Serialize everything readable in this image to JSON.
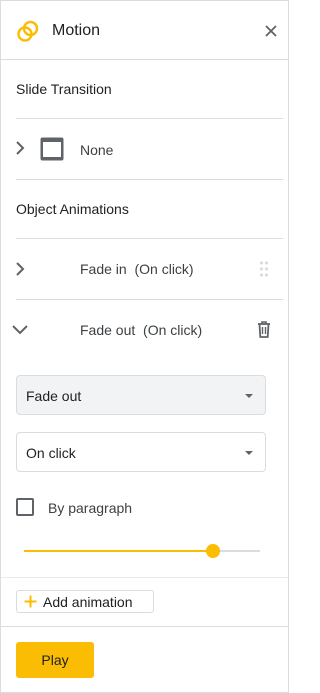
{
  "header": {
    "title": "Motion"
  },
  "slide_transition": {
    "section_title": "Slide Transition",
    "value": "None"
  },
  "object_animations": {
    "section_title": "Object Animations",
    "items": [
      {
        "label": "Fade in  (On click)",
        "expanded": false
      },
      {
        "label": "Fade out  (On click)",
        "expanded": true
      }
    ],
    "effect_select": {
      "value": "Fade out"
    },
    "trigger_select": {
      "value": "On click"
    },
    "by_paragraph": {
      "label": "By paragraph",
      "checked": false
    },
    "speed_slider": {
      "value": 0.8
    }
  },
  "footer": {
    "add_animation_label": "Add animation",
    "play_label": "Play"
  },
  "colors": {
    "accent": "#fbbc04",
    "border": "#dadce0",
    "select_bg": "#f1f3f4",
    "icon": "#5f6368"
  },
  "icons": {
    "logo": "motion-logo-icon",
    "close": "close-icon",
    "expand": "chevron-right-icon",
    "collapse": "chevron-down-icon",
    "transition_thumb": "slide-thumbnail-icon",
    "drag": "drag-handle-icon",
    "delete": "trash-icon",
    "add": "plus-icon"
  }
}
